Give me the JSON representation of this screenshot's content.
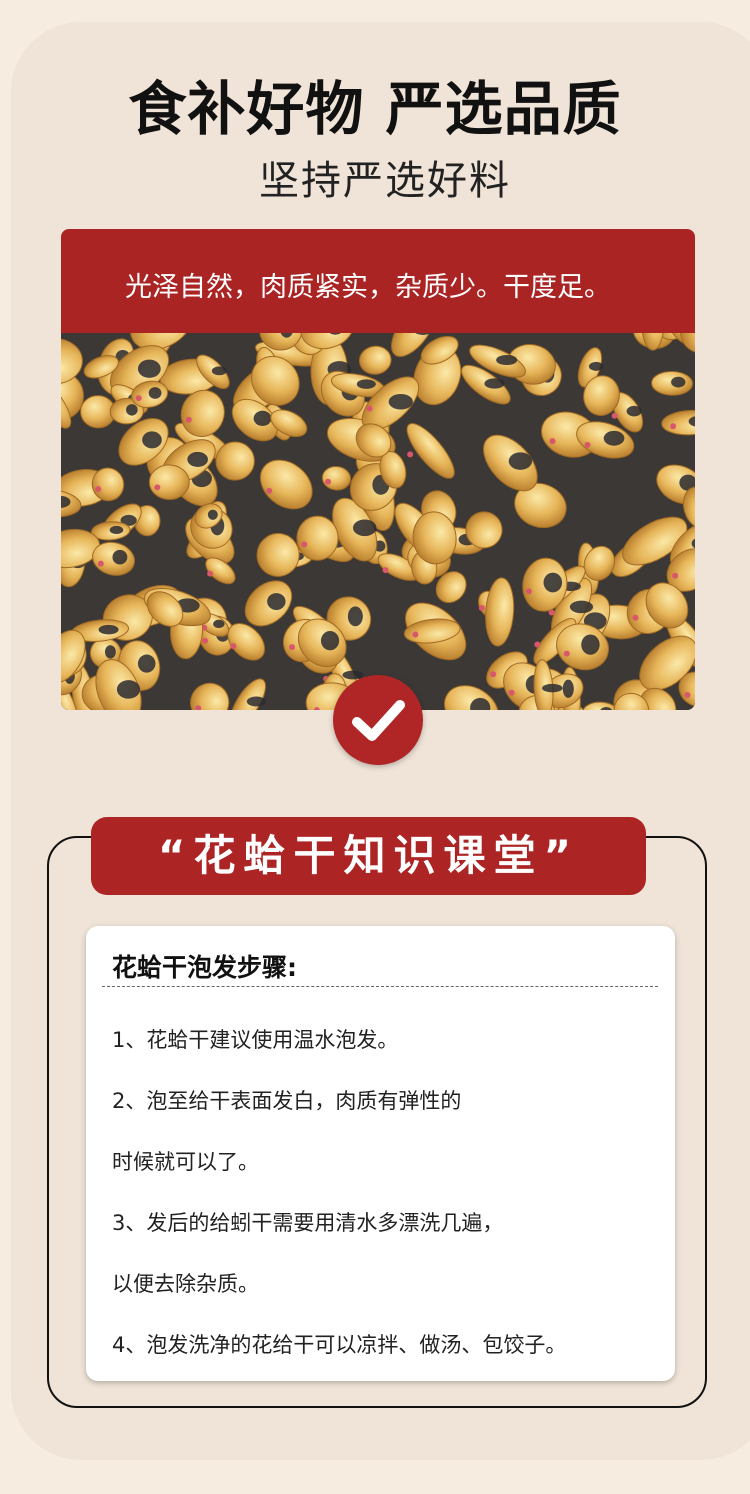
{
  "header": {
    "title": "食补好物 严选品质",
    "subtitle": "坚持严选好料"
  },
  "banner": {
    "text": "光泽自然，肉质紧实，杂质少。干度足。"
  },
  "photo": {
    "icon": "dried-clam-photo"
  },
  "badge": {
    "icon": "checkmark-icon",
    "color": "#b02626"
  },
  "knowledge": {
    "heading": "“花蛤干知识课堂”",
    "steps_title": "花蛤干泡发步骤:",
    "lines": [
      "1、花蛤干建议使用温水泡发。",
      "2、泡至给干表面发白，肉质有弹性的",
      "时候就可以了。",
      "3、发后的给蚓干需要用清水多漂洗几遍，",
      "以便去除杂质。",
      "4、泡发洗净的花给干可以凉拌、做汤、包饺子。"
    ]
  },
  "colors": {
    "accent": "#aa2424",
    "background": "#efe4d7"
  }
}
